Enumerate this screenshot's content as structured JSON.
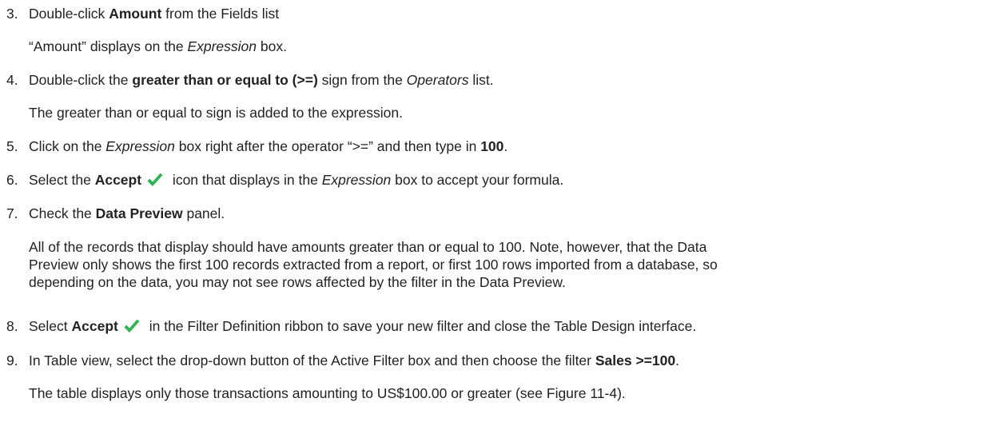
{
  "steps": [
    {
      "num": "3.",
      "parts": [
        "Double-click ",
        "Amount",
        " from the Fields list"
      ],
      "note": [
        "“Amount” displays on the ",
        "Expression",
        " box."
      ]
    },
    {
      "num": "4.",
      "parts": [
        "Double-click the ",
        "greater than or equal to (>=)",
        " sign from the ",
        "Operators",
        " list."
      ],
      "note": "The greater than or equal to sign is added to the expression."
    },
    {
      "num": "5.",
      "parts": [
        "Click on the ",
        "Expression",
        " box right after the operator “>=” and then type in ",
        "100",
        "."
      ]
    },
    {
      "num": "6.",
      "parts": [
        "Select the ",
        "Accept",
        " icon that displays in the ",
        "Expression",
        " box to accept your formula."
      ]
    },
    {
      "num": "7.",
      "parts": [
        "Check the ",
        "Data Preview",
        " panel."
      ],
      "note_lines": [
        "All of the records that display should have amounts greater than or equal to 100. Note, however, that the Data",
        "Preview only shows the first 100 records extracted from a report, or first 100 rows imported from a database, so",
        "depending on the data, you may not see rows affected by the filter in the Data Preview."
      ]
    },
    {
      "num": "8.",
      "parts": [
        "Select ",
        "Accept",
        " in the Filter Definition ribbon to save your new filter and close the Table Design interface."
      ]
    },
    {
      "num": "9.",
      "parts": [
        "In Table view, select the drop-down button of the Active Filter box and then choose the filter ",
        "Sales >=100",
        "."
      ],
      "note": "The table displays only those transactions amounting to US$100.00 or greater (see Figure 11-4)."
    }
  ],
  "icons": {
    "accept": "checkmark-icon",
    "accept_color": "#2fb350"
  }
}
